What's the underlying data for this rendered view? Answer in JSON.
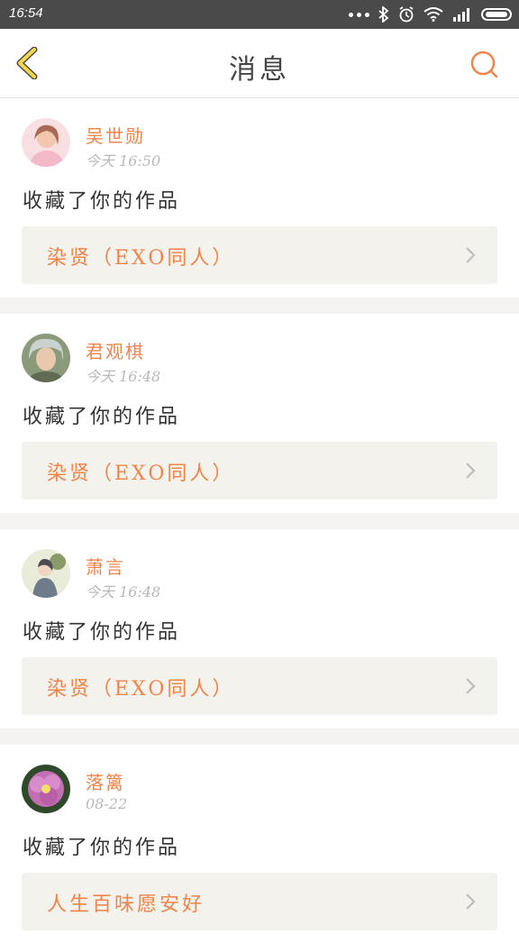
{
  "status_bar": {
    "time": "16:54",
    "icons": [
      "more-dots-icon",
      "bluetooth-icon",
      "alarm-icon",
      "wifi-icon",
      "signal-icon",
      "battery-icon"
    ]
  },
  "header": {
    "title": "消息",
    "back_icon": "chevron-left-icon",
    "search_icon": "search-icon",
    "accent_color": "#f0844a",
    "back_color": "#f5d84a"
  },
  "messages": [
    {
      "user": "吴世勋",
      "time": "今天 16:50",
      "action": "收藏了你的作品",
      "work": "染贤（EXO同人）"
    },
    {
      "user": "君观棋",
      "time": "今天 16:48",
      "action": "收藏了你的作品",
      "work": "染贤（EXO同人）"
    },
    {
      "user": "萧言",
      "time": "今天 16:48",
      "action": "收藏了你的作品",
      "work": "染贤（EXO同人）"
    },
    {
      "user": "落篱",
      "time": "08-22",
      "action": "收藏了你的作品",
      "work": "人生百味愿安好"
    }
  ]
}
